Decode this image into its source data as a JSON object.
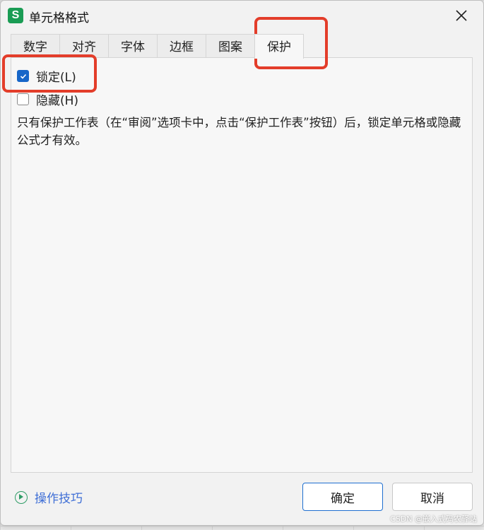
{
  "dialog": {
    "app_icon_letter": "S",
    "title": "单元格格式"
  },
  "tabs": [
    {
      "label": "数字",
      "active": false
    },
    {
      "label": "对齐",
      "active": false
    },
    {
      "label": "字体",
      "active": false
    },
    {
      "label": "边框",
      "active": false
    },
    {
      "label": "图案",
      "active": false
    },
    {
      "label": "保护",
      "active": true
    }
  ],
  "protection": {
    "locked": {
      "label": "锁定(L)",
      "checked": true
    },
    "hidden": {
      "label": "隐藏(H)",
      "checked": false
    },
    "description": "只有保护工作表（在“审阅”选项卡中，点击“保护工作表”按钮）后，锁定单元格或隐藏公式才有效。"
  },
  "footer": {
    "tips_label": "操作技巧",
    "ok_label": "确定",
    "cancel_label": "取消"
  },
  "watermark": "CSDN @嵌入式码农驿站",
  "colors": {
    "accent": "#1766c8",
    "highlight": "#e33d2a",
    "app_icon": "#1a9c54",
    "link": "#3f6fd6"
  }
}
